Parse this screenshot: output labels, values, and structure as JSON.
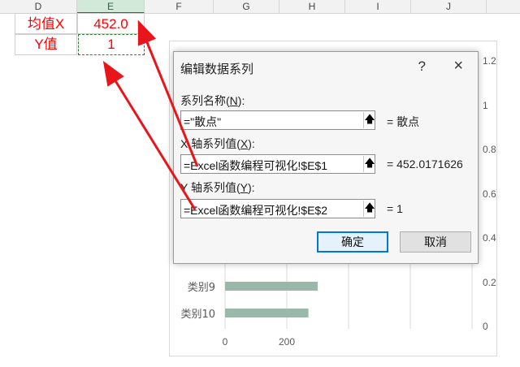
{
  "sheet": {
    "column_headers": [
      "D",
      "E",
      "F",
      "G",
      "H",
      "I",
      "J"
    ],
    "selected_column": "E",
    "row1": {
      "label": "均值X",
      "value": "452.0"
    },
    "row2": {
      "label": "Y值",
      "value": "1"
    }
  },
  "chart": {
    "categories": [
      "类别9",
      "类别10"
    ],
    "category_values": [
      300,
      270
    ],
    "x_ticks": [
      "0",
      "200"
    ],
    "y_ticks": [
      "1.2",
      "1",
      "0.8",
      "0.6",
      "0.4",
      "0.2",
      "0"
    ],
    "bar_color": "#9ab8aa"
  },
  "dialog": {
    "title": "编辑数据系列",
    "help": "?",
    "close": "×",
    "series_name": {
      "label_pre": "系列名称(",
      "label_key": "N",
      "label_post": "):",
      "value": "=\"散点\"",
      "result": "= 散点"
    },
    "x_values": {
      "label_pre": "X 轴系列值(",
      "label_key": "X",
      "label_post": "):",
      "value": "=Excel函数编程可视化!$E$1",
      "result": "= 452.0171626"
    },
    "y_values": {
      "label_pre": "Y 轴系列值(",
      "label_key": "Y",
      "label_post": "):",
      "value": "=Excel函数编程可视化!$E$2",
      "result": "= 1"
    },
    "ok_label": "确定",
    "cancel_label": "取消"
  },
  "annotation_color": "#e8161b"
}
